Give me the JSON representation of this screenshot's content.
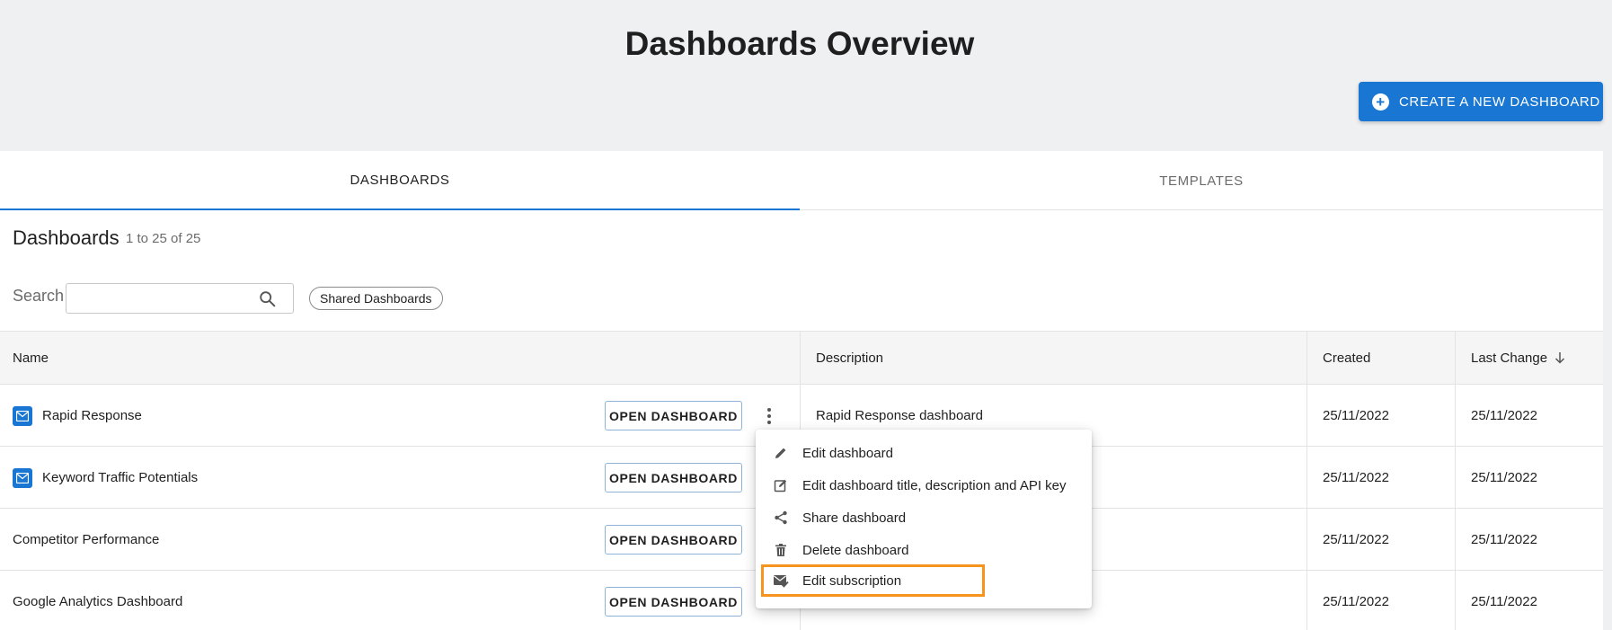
{
  "header": {
    "title": "Dashboards Overview",
    "create_button_label": "CREATE A NEW DASHBOARD"
  },
  "tabs": [
    {
      "label": "DASHBOARDS",
      "active": true
    },
    {
      "label": "TEMPLATES",
      "active": false
    }
  ],
  "section": {
    "title": "Dashboards",
    "count": "1 to 25 of 25"
  },
  "search": {
    "label": "Search",
    "value": "",
    "filter_chip": "Shared Dashboards"
  },
  "table": {
    "columns": {
      "name": "Name",
      "description": "Description",
      "created": "Created",
      "last_change": "Last Change"
    },
    "open_label": "OPEN DASHBOARD",
    "rows": [
      {
        "name": "Rapid Response",
        "has_icon": true,
        "description": "Rapid Response dashboard",
        "created": "25/11/2022",
        "last_change": "25/11/2022"
      },
      {
        "name": "Keyword Traffic Potentials",
        "has_icon": true,
        "description": "",
        "created": "25/11/2022",
        "last_change": "25/11/2022"
      },
      {
        "name": "Competitor Performance",
        "has_icon": false,
        "description": "",
        "created": "25/11/2022",
        "last_change": "25/11/2022"
      },
      {
        "name": "Google Analytics Dashboard",
        "has_icon": false,
        "description": "",
        "created": "25/11/2022",
        "last_change": "25/11/2022"
      }
    ]
  },
  "context_menu": {
    "items": [
      {
        "label": "Edit dashboard",
        "icon": "pencil-icon"
      },
      {
        "label": "Edit dashboard title, description and API key",
        "icon": "edit-square-icon"
      },
      {
        "label": "Share dashboard",
        "icon": "share-icon"
      },
      {
        "label": "Delete dashboard",
        "icon": "trash-icon"
      },
      {
        "label": "Edit subscription",
        "icon": "mail-check-icon",
        "highlighted": true
      }
    ]
  },
  "colors": {
    "accent": "#1976d2",
    "highlight": "#f7941d",
    "background": "#eff0f2"
  }
}
